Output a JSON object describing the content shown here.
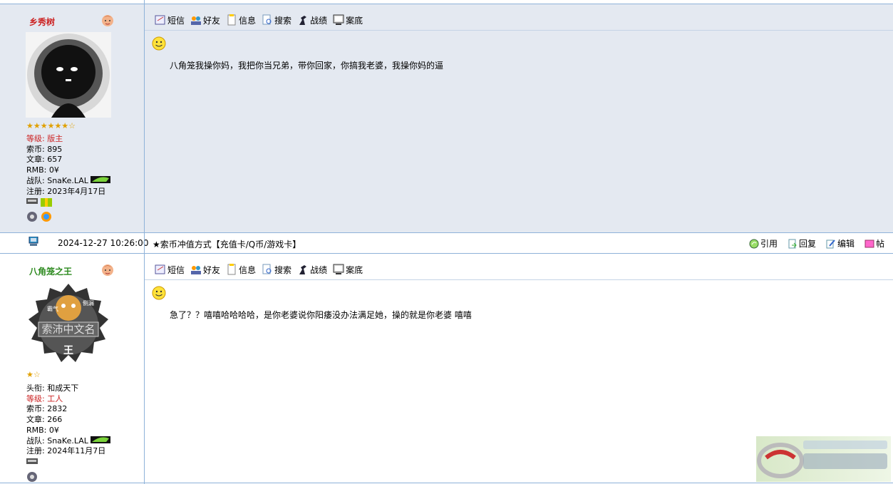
{
  "posts": [
    {
      "username": "乡秀树",
      "stars": "★★★★★★☆",
      "info": {
        "rank_label": "等级:",
        "rank": "版主",
        "coins_label": "索币:",
        "coins": "895",
        "articles_label": "文章:",
        "articles": "657",
        "rmb_label": "RMB:",
        "rmb": "0¥",
        "team_label": "战队:",
        "team": "SnaKe.LAL",
        "joined_label": "注册:",
        "joined": "2023年4月17日"
      },
      "toolbar": [
        "短信",
        "好友",
        "信息",
        "搜索",
        "战绩",
        "案底"
      ],
      "text": "八角笼我操你妈，我把你当兄弟，带你回家，你搞我老婆，我操你妈的逼"
    },
    {
      "username": "八角笼之王",
      "stars": "★☆",
      "info": {
        "title_label": "头衔:",
        "title": "和成天下",
        "rank_label": "等级:",
        "rank": "工人",
        "coins_label": "索币:",
        "coins": "2832",
        "articles_label": "文章:",
        "articles": "266",
        "rmb_label": "RMB:",
        "rmb": "0¥",
        "team_label": "战队:",
        "team": "SnaKe.LAL",
        "joined_label": "注册:",
        "joined": "2024年11月7日"
      },
      "toolbar": [
        "短信",
        "好友",
        "信息",
        "搜索",
        "战绩",
        "案底"
      ],
      "text": "急了？？嘻嘻哈哈哈哈，是你老婆说你阳痿没办法满足她，操的就是你老婆 嘻嘻",
      "avatar_text": [
        "霸气",
        "侧漏",
        "索沛中文名",
        "王"
      ]
    }
  ],
  "meta": {
    "datetime": "2024-12-27 10:26:00",
    "signature": "★索币冲值方式【充值卡/Q币/游戏卡】",
    "actions": [
      "引用",
      "回复",
      "编辑",
      "帖"
    ]
  },
  "colors": {
    "border": "#8eb2d9",
    "post_bg": "#e4e9f1",
    "name_red": "#cc2222",
    "name_green": "#2d8a1f"
  }
}
